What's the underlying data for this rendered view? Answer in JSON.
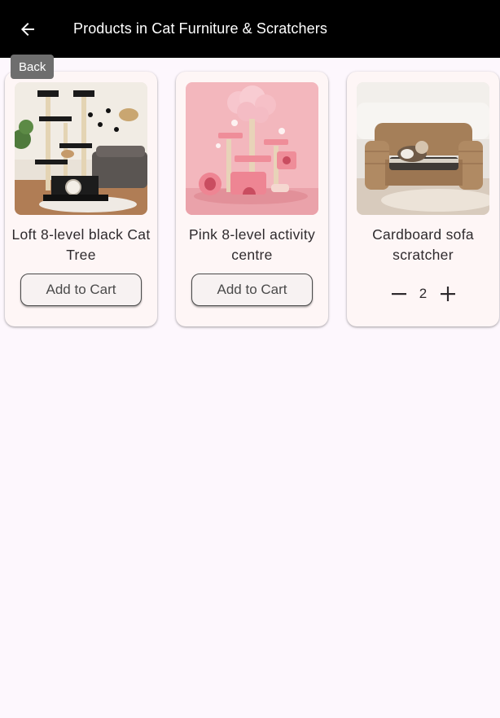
{
  "app_bar": {
    "title": "Products in Cat Furniture & Scratchers",
    "back_icon": "arrow-left-icon",
    "back_tooltip": "Back",
    "background": "#000000"
  },
  "products": [
    {
      "name": "Loft 8-level black Cat Tree",
      "image_subject": "black cat tree",
      "action": "Add to Cart",
      "in_cart": false
    },
    {
      "name": "Pink 8-level activity centre",
      "image_subject": "pink cat activity centre",
      "action": "Add to Cart",
      "in_cart": false
    },
    {
      "name": "Cardboard sofa scratcher",
      "image_subject": "cardboard sofa scratcher with cat",
      "in_cart": true,
      "quantity": "2",
      "decrement_icon": "minus-icon",
      "increment_icon": "plus-icon"
    }
  ],
  "colors": {
    "page_background": "#fdf7fd",
    "card_background": "#fef6f6",
    "text": "#2e2a2d"
  }
}
